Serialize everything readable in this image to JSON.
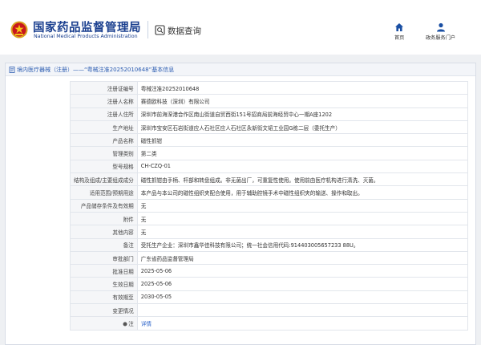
{
  "header": {
    "brand_cn": "国家药品监督管理局",
    "brand_en": "National Medical Products Administration",
    "section_title": "数据查询",
    "brand_color": "#1a3f8f",
    "nav": [
      {
        "label": "首页",
        "icon": "home-icon"
      },
      {
        "label": "政务服务门户",
        "icon": "user-icon"
      }
    ]
  },
  "panel": {
    "title_prefix": "境内医疗器械（注册）——",
    "title_name": "“粤械注准20252010648”",
    "title_suffix": "基本信息"
  },
  "rows": [
    {
      "label": "注册证编号",
      "value": "粤械注准20252010648"
    },
    {
      "label": "注册人名称",
      "value": "赛德欧科技（深圳）有限公司"
    },
    {
      "label": "注册人住所",
      "value": "深圳市前海深港合作区南山街道自贸西街151号招商局前海经贸中心一期A座1202"
    },
    {
      "label": "生产地址",
      "value": "深圳市宝安区石岩街道应人石社区应人石社区永新街文韬工业园G栋二层（委托生产）"
    },
    {
      "label": "产品名称",
      "value": "磁性抓钳"
    },
    {
      "label": "管理类别",
      "value": "第二类"
    },
    {
      "label": "型号规格",
      "value": "CH-CZQ-01"
    },
    {
      "label": "结构及组成/主要组成成分",
      "value": "磁性抓钳由手柄、杆部和转盘组成。非无菌出厂，可重复性使用。使用前由医疗机构进行清洗、灭菌。"
    },
    {
      "label": "适用范围/预期用途",
      "value": "本产品与本公司的磁性组织夹配合使用，用于辅助腔镜手术中磁性组织夹的输送、操作和取出。"
    },
    {
      "label": "产品储存条件及有效期",
      "value": "无"
    },
    {
      "label": "附件",
      "value": "无"
    },
    {
      "label": "其他内容",
      "value": "无"
    },
    {
      "label": "备注",
      "value": "受托生产企业：深圳市鑫华佳科技有限公司；统一社会信用代码:914403005657233 88U。"
    },
    {
      "label": "审批部门",
      "value": "广东省药品监督管理局"
    },
    {
      "label": "批准日期",
      "value": "2025-05-06"
    },
    {
      "label": "生效日期",
      "value": "2025-05-06"
    },
    {
      "label": "有效期至",
      "value": "2030-05-05"
    },
    {
      "label": "变更情况",
      "value": ""
    },
    {
      "label": "注",
      "value": "详情",
      "link": true
    }
  ]
}
